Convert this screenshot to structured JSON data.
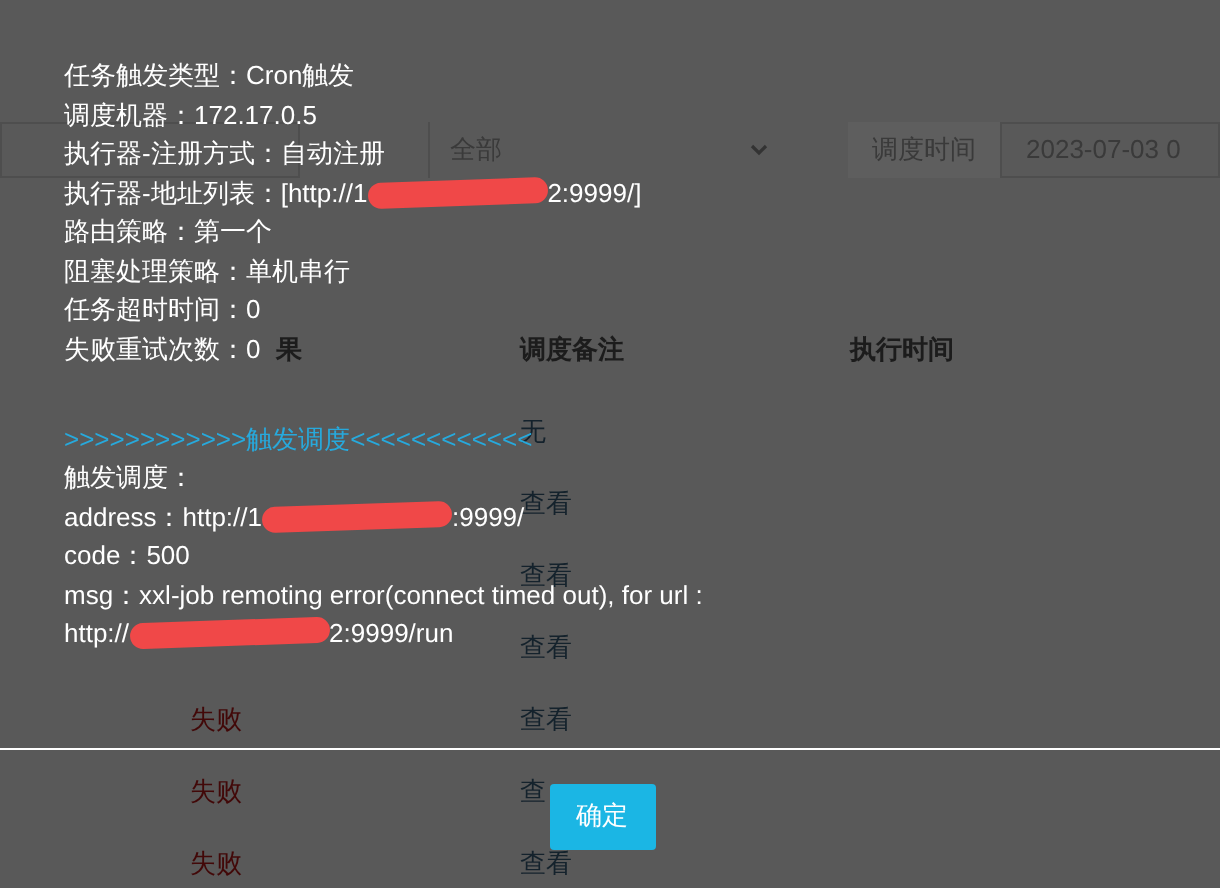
{
  "filter_bar": {
    "status_value": "全部",
    "time_button": "调度时间",
    "time_value": "2023-07-03 0"
  },
  "table": {
    "columns": [
      "果",
      "调度备注",
      "执行时间"
    ],
    "rows": [
      {
        "remark": "无"
      },
      {
        "remark": "查看"
      },
      {
        "remark": "查看"
      },
      {
        "remark": "查看"
      },
      {
        "result": "失败",
        "remark": "查看"
      },
      {
        "result": "失败",
        "remark": "查"
      },
      {
        "result": "失败",
        "remark": "查看"
      }
    ]
  },
  "dialog": {
    "lines": [
      {
        "kind": "info",
        "parts": [
          {
            "kind": "text",
            "text": "任务触发类型：Cron触发"
          }
        ]
      },
      {
        "kind": "info",
        "parts": [
          {
            "kind": "text",
            "text": "调度机器：172.17.0.5"
          }
        ]
      },
      {
        "kind": "info",
        "parts": [
          {
            "kind": "text",
            "text": "执行器-注册方式：自动注册"
          }
        ]
      },
      {
        "kind": "info",
        "parts": [
          {
            "kind": "text",
            "text": "执行器-地址列表：[http://1"
          },
          {
            "kind": "redaction"
          },
          {
            "kind": "text",
            "text": "2:9999/]"
          }
        ]
      },
      {
        "kind": "info",
        "parts": [
          {
            "kind": "text",
            "text": "路由策略：第一个"
          }
        ]
      },
      {
        "kind": "info",
        "parts": [
          {
            "kind": "text",
            "text": "阻塞处理策略：单机串行"
          }
        ]
      },
      {
        "kind": "info",
        "parts": [
          {
            "kind": "text",
            "text": "任务超时时间：0"
          }
        ]
      },
      {
        "kind": "info",
        "parts": [
          {
            "kind": "text",
            "text": "失败重试次数：0"
          }
        ]
      },
      {
        "kind": "heading",
        "parts": [
          {
            "kind": "text",
            "text": ">>>>>>>>>>>>触发调度<<<<<<<<<<<<"
          }
        ]
      },
      {
        "kind": "info",
        "parts": [
          {
            "kind": "text",
            "text": "触发调度："
          }
        ]
      },
      {
        "kind": "info",
        "parts": [
          {
            "kind": "text",
            "text": "address：http://1"
          },
          {
            "kind": "redaction"
          },
          {
            "kind": "text",
            "text": ":9999/"
          }
        ]
      },
      {
        "kind": "info",
        "parts": [
          {
            "kind": "text",
            "text": "code：500"
          }
        ]
      },
      {
        "kind": "info",
        "parts": [
          {
            "kind": "text",
            "text": "msg：xxl-job remoting error(connect timed out), for url :"
          }
        ]
      },
      {
        "kind": "info",
        "parts": [
          {
            "kind": "text",
            "text": "http://"
          },
          {
            "kind": "redaction"
          },
          {
            "kind": "text",
            "text": "2:9999/run"
          }
        ]
      }
    ],
    "button": "确定"
  }
}
